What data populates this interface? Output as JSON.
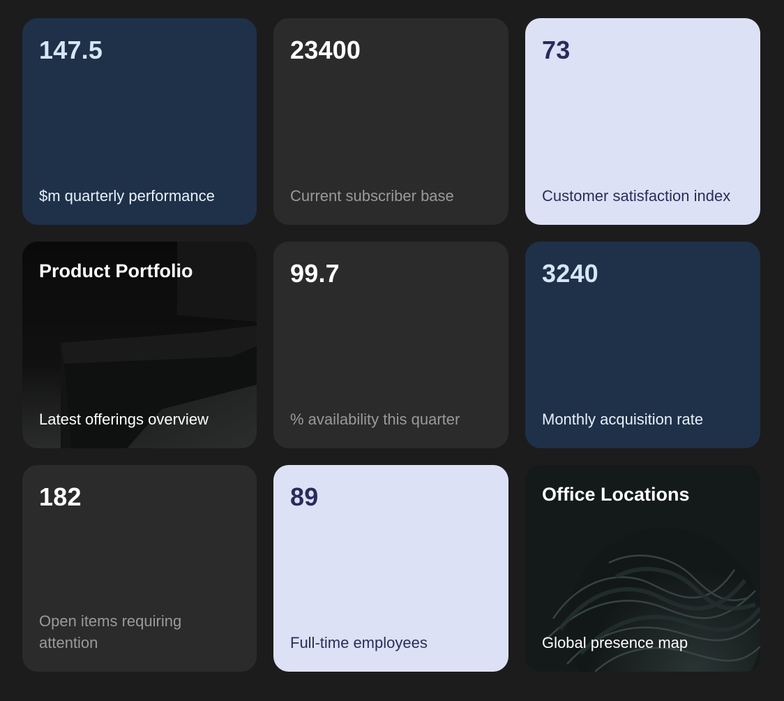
{
  "cards": [
    {
      "value": "147.5",
      "label": "$m quarterly performance"
    },
    {
      "value": "23400",
      "label": "Current subscriber base"
    },
    {
      "value": "73",
      "label": "Customer satisfaction index"
    },
    {
      "title": "Product Portfolio",
      "label": "Latest offerings overview"
    },
    {
      "value": "99.7",
      "label": "% availability this quarter"
    },
    {
      "value": "3240",
      "label": "Monthly acquisition rate"
    },
    {
      "value": "182",
      "label": "Open items requiring attention"
    },
    {
      "value": "89",
      "label": "Full-time employees"
    },
    {
      "title": "Office Locations",
      "label": "Global presence map"
    }
  ],
  "colors": {
    "page_background": "#1c1c1c",
    "navy_card": "#1f3049",
    "gray_card": "#2b2b2b",
    "lavender_card": "#dde1f5"
  }
}
